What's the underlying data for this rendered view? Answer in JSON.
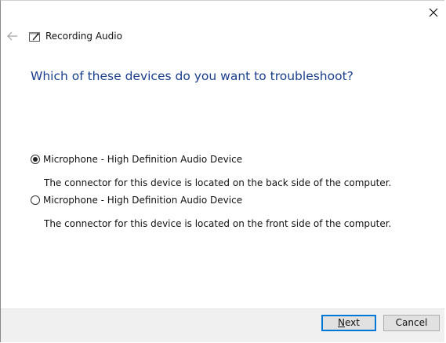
{
  "window": {
    "title": "Recording Audio"
  },
  "heading": "Which of these devices do you want to troubleshoot?",
  "options": [
    {
      "label": "Microphone - High Definition Audio Device",
      "description": "The connector for this device is located on the back side of the computer.",
      "selected": true
    },
    {
      "label": "Microphone - High Definition Audio Device",
      "description": "The connector for this device is located on the front side of the computer.",
      "selected": false
    }
  ],
  "footer": {
    "next_accel": "N",
    "next_rest": "ext",
    "cancel_label": "Cancel"
  },
  "icons": {
    "close": "close-icon",
    "back": "back-arrow-icon",
    "app": "troubleshooter-icon"
  },
  "colors": {
    "heading": "#1a3e8c",
    "default_button_border": "#0078d7",
    "footer_bg": "#f0f0f0"
  }
}
